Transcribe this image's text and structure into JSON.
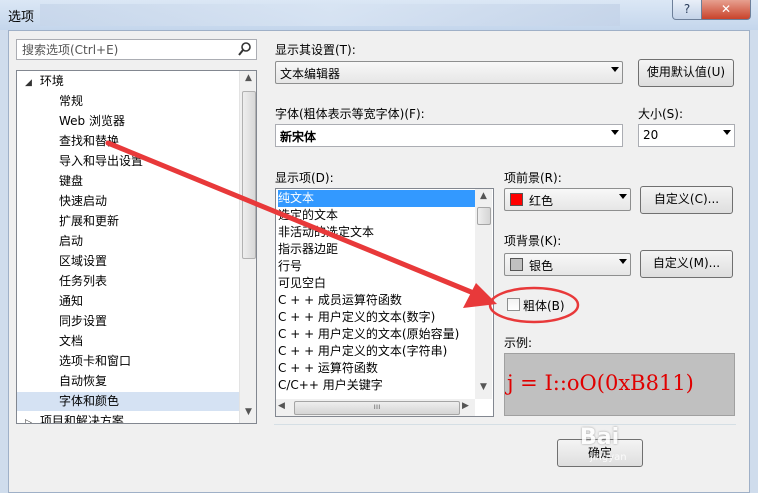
{
  "window": {
    "title": "选项",
    "help_label": "?",
    "close_label": "✕"
  },
  "search": {
    "placeholder": "搜索选项(Ctrl+E)"
  },
  "tree": {
    "root": "环境",
    "items": [
      "常规",
      "Web 浏览器",
      "查找和替换",
      "导入和导出设置",
      "键盘",
      "快速启动",
      "扩展和更新",
      "启动",
      "区域设置",
      "任务列表",
      "通知",
      "同步设置",
      "文档",
      "选项卡和窗口",
      "自动恢复",
      "字体和颜色"
    ],
    "selected": "字体和颜色",
    "next_root": "项目和解决方案"
  },
  "settings": {
    "show_settings_for_label": "显示其设置(T):",
    "show_settings_for_value": "文本编辑器",
    "use_defaults_label": "使用默认值(U)",
    "font_label": "字体(粗体表示等宽字体)(F):",
    "font_value": "新宋体",
    "size_label": "大小(S):",
    "size_value": "20",
    "display_items_label": "显示项(D):",
    "display_items": [
      "纯文本",
      "选定的文本",
      "非活动的选定文本",
      "指示器边距",
      "行号",
      "可见空白",
      "C + + 成员运算符函数",
      "C + + 用户定义的文本(数字)",
      "C + + 用户定义的文本(原始容量)",
      "C + + 用户定义的文本(字符串)",
      "C + + 运算符函数",
      "C/C++ 用户关键字"
    ],
    "item_foreground_label": "项前景(R):",
    "item_foreground_value": "红色",
    "item_foreground_color": "#ff0000",
    "item_background_label": "项背景(K):",
    "item_background_value": "银色",
    "item_background_color": "#c0c0c0",
    "custom_fg_label": "自定义(C)...",
    "custom_bg_label": "自定义(M)...",
    "bold_label": "粗体(B)",
    "bold_checked": false,
    "sample_label": "示例:",
    "sample_text": "j = I::oO(0xB811)"
  },
  "footer": {
    "ok_label": "确定"
  },
  "watermark": {
    "text": "Bai",
    "sub": "jingyan"
  },
  "colors": {
    "annotation": "#e8393a"
  }
}
